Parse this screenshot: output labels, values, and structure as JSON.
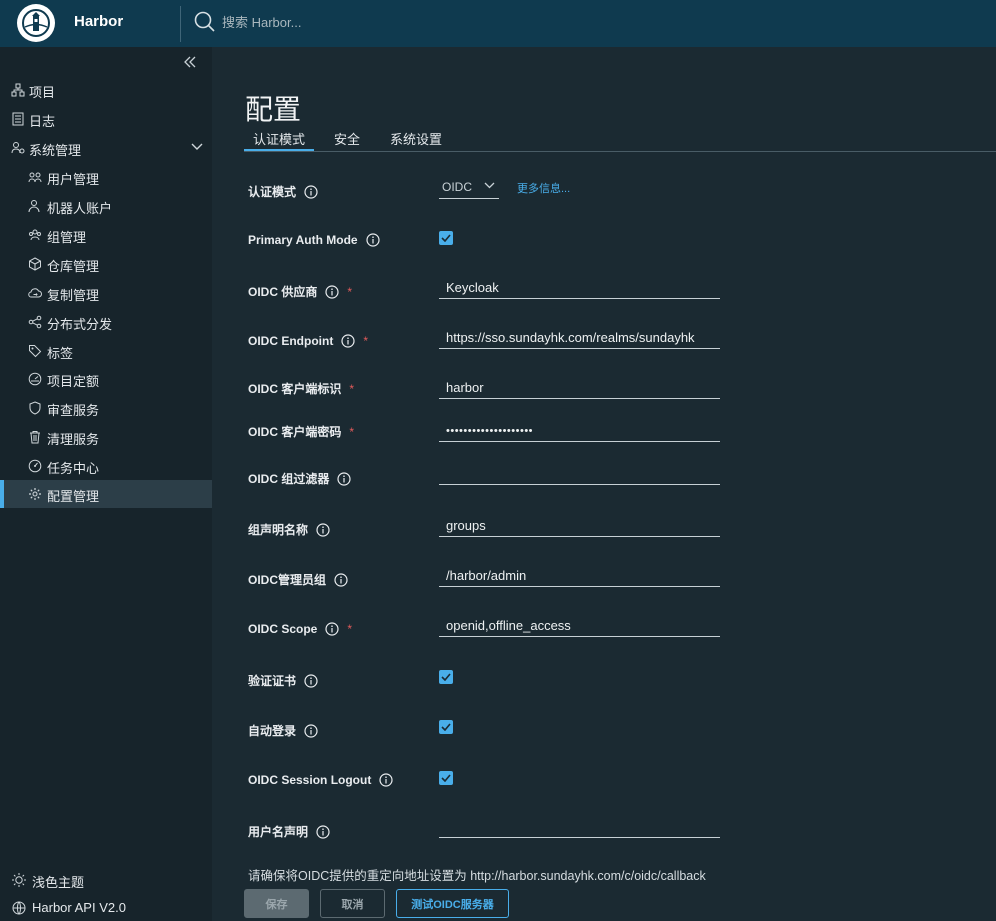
{
  "header": {
    "brand": "Harbor",
    "search_placeholder": "搜索 Harbor..."
  },
  "sidebar": {
    "items": [
      {
        "label": "项目"
      },
      {
        "label": "日志"
      },
      {
        "label": "系统管理"
      }
    ],
    "sub_items": [
      {
        "label": "用户管理"
      },
      {
        "label": "机器人账户"
      },
      {
        "label": "组管理"
      },
      {
        "label": "仓库管理"
      },
      {
        "label": "复制管理"
      },
      {
        "label": "分布式分发"
      },
      {
        "label": "标签"
      },
      {
        "label": "项目定额"
      },
      {
        "label": "审查服务"
      },
      {
        "label": "清理服务"
      },
      {
        "label": "任务中心"
      },
      {
        "label": "配置管理"
      }
    ],
    "footer": {
      "theme_label": "浅色主题",
      "api_label": "Harbor API V2.0"
    }
  },
  "main": {
    "title": "配置",
    "tabs": [
      {
        "label": "认证模式"
      },
      {
        "label": "安全"
      },
      {
        "label": "系统设置"
      }
    ]
  },
  "form": {
    "auth_mode": {
      "label": "认证模式",
      "value": "OIDC",
      "more_link": "更多信息..."
    },
    "primary_auth_mode": {
      "label": "Primary Auth Mode",
      "checked": true
    },
    "oidc_provider": {
      "label": "OIDC 供应商",
      "value": "Keycloak",
      "required": "*"
    },
    "oidc_endpoint": {
      "label": "OIDC Endpoint",
      "value": "https://sso.sundayhk.com/realms/sundayhk",
      "required": "*"
    },
    "oidc_client_id": {
      "label": "OIDC 客户端标识",
      "value": "harbor",
      "required": "*"
    },
    "oidc_client_secret": {
      "label": "OIDC 客户端密码",
      "value": "••••••••••••••••••••",
      "required": "*"
    },
    "oidc_group_filter": {
      "label": "OIDC 组过滤器",
      "value": ""
    },
    "group_claim_name": {
      "label": "组声明名称",
      "value": "groups"
    },
    "oidc_admin_group": {
      "label": "OIDC管理员组",
      "value": "/harbor/admin"
    },
    "oidc_scope": {
      "label": "OIDC Scope",
      "value": "openid,offline_access",
      "required": "*"
    },
    "verify_cert": {
      "label": "验证证书",
      "checked": true
    },
    "auto_onboard": {
      "label": "自动登录",
      "checked": true
    },
    "session_logout": {
      "label": "OIDC Session Logout",
      "checked": true
    },
    "username_claim": {
      "label": "用户名声明",
      "value": ""
    },
    "redirect_note": "请确保将OIDC提供的重定向地址设置为 http://harbor.sundayhk.com/c/oidc/callback"
  },
  "buttons": {
    "save": "保存",
    "cancel": "取消",
    "test": "测试OIDC服务器"
  },
  "colors": {
    "header_bg": "#0f3a4f",
    "sidebar_bg": "#17242b",
    "main_bg": "#1b2a32",
    "accent": "#49aeea",
    "required": "#e35b5b"
  }
}
